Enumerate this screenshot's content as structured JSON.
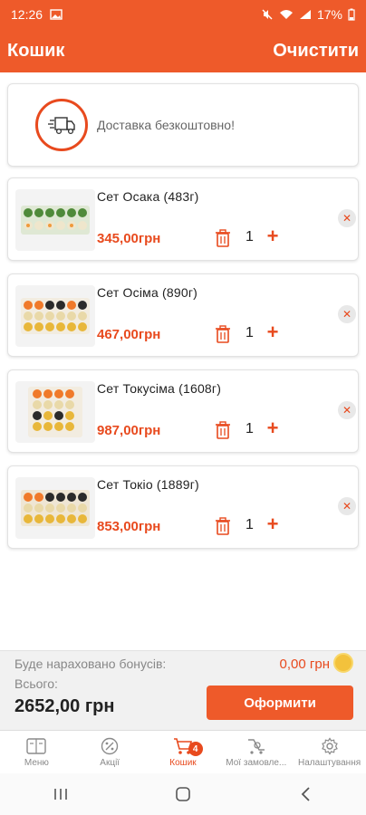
{
  "status_bar": {
    "time": "12:26",
    "battery": "17%"
  },
  "header": {
    "title": "Кошик",
    "clear_label": "Очистити"
  },
  "delivery": {
    "text": "Доставка безкоштовно!"
  },
  "cart": {
    "items": [
      {
        "name": "Сет Осака (483г)",
        "price": "345,00грн",
        "qty": "1"
      },
      {
        "name": "Сет Осіма (890г)",
        "price": "467,00грн",
        "qty": "1"
      },
      {
        "name": "Сет Токусіма (1608г)",
        "price": "987,00грн",
        "qty": "1"
      },
      {
        "name": "Сет Токіо (1889г)",
        "price": "853,00грн",
        "qty": "1"
      }
    ]
  },
  "footer": {
    "bonus_label": "Буде нараховано бонусів:",
    "bonus_value": "0,00 грн",
    "total_label": "Всього:",
    "total_value": "2652,00 грн",
    "checkout_label": "Оформити"
  },
  "bottom_nav": {
    "items": [
      {
        "label": "Меню",
        "icon": "menu-icon"
      },
      {
        "label": "Акції",
        "icon": "percent-icon"
      },
      {
        "label": "Кошик",
        "icon": "cart-icon",
        "badge": "4",
        "active": true
      },
      {
        "label": "Мої замовле...",
        "icon": "orders-icon"
      },
      {
        "label": "Налаштування",
        "icon": "settings-icon"
      }
    ]
  },
  "colors": {
    "brand": "#ee5a2a",
    "accent": "#e84a1e"
  }
}
